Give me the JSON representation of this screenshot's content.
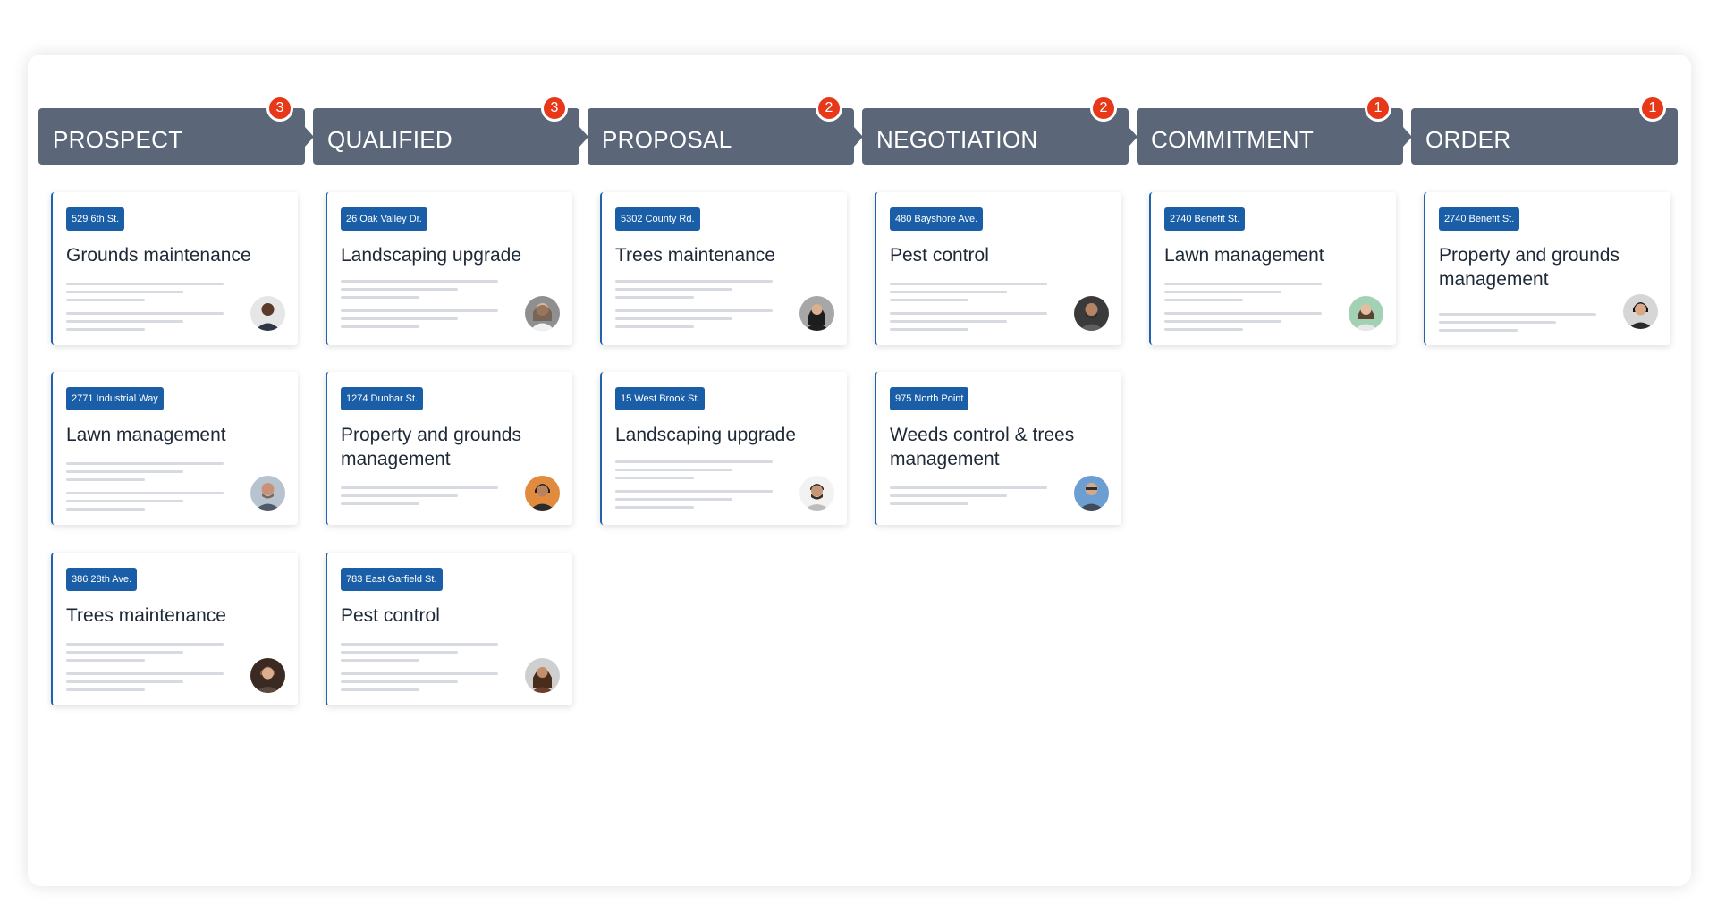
{
  "stages": [
    {
      "label": "PROSPECT",
      "count": "3"
    },
    {
      "label": "QUALIFIED",
      "count": "3"
    },
    {
      "label": "PROPOSAL",
      "count": "2"
    },
    {
      "label": "NEGOTIATION",
      "count": "2"
    },
    {
      "label": "COMMITMENT",
      "count": "1"
    },
    {
      "label": "ORDER",
      "count": "1"
    }
  ],
  "cards": [
    {
      "address": "529 6th St.",
      "title": "Grounds maintenance"
    },
    {
      "address": "26 Oak Valley Dr.",
      "title": "Landscaping upgrade"
    },
    {
      "address": "5302 County Rd.",
      "title": "Trees maintenance"
    },
    {
      "address": "480 Bayshore Ave.",
      "title": "Pest control"
    },
    {
      "address": "2740 Benefit St.",
      "title": "Lawn management"
    },
    {
      "address": "2740 Benefit St.",
      "title": "Property and grounds management"
    },
    {
      "address": "2771 Industrial Way",
      "title": "Lawn management"
    },
    {
      "address": "1274 Dunbar St.",
      "title": "Property and grounds management"
    },
    {
      "address": "15 West Brook St.",
      "title": "Landscaping upgrade"
    },
    {
      "address": "975 North Point",
      "title": "Weeds control & trees management"
    },
    {
      "address": "386 28th Ave.",
      "title": "Trees maintenance"
    },
    {
      "address": "783 East Garfield St.",
      "title": "Pest control"
    }
  ],
  "colors": {
    "stage_bg": "#5b6779",
    "count_badge": "#e8381a",
    "address_tag": "#1a5ea8",
    "card_accent": "#1f63ae"
  },
  "icons": {
    "avatar": "person-avatar-icon"
  }
}
